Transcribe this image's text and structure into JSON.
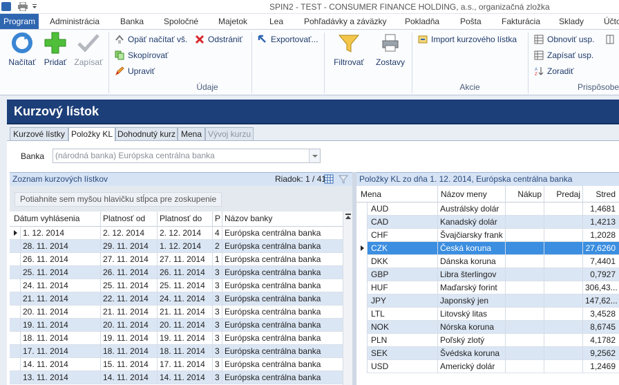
{
  "title_bar": {
    "text": "SPIN2 - TEST - CONSUMER FINANCE HOLDING, a.s., organizačná zložka"
  },
  "menu": {
    "items": [
      {
        "label": "Program",
        "active": true
      },
      {
        "label": "Administrácia"
      },
      {
        "label": "Banka"
      },
      {
        "label": "Spoločné"
      },
      {
        "label": "Majetok"
      },
      {
        "label": "Lea"
      },
      {
        "label": "Pohľadávky a záväzky"
      },
      {
        "label": "Pokladňa"
      },
      {
        "label": "Pošta"
      },
      {
        "label": "Fakturácia"
      },
      {
        "label": "Sklady"
      },
      {
        "label": "Účto"
      }
    ]
  },
  "ribbon": {
    "nacitat": "Načítať",
    "pridat": "Pridať",
    "zapisat": "Zapísať",
    "opat_nacitat": "Opäť načítať vš.",
    "odstranit": "Odstrániť",
    "skopirovat": "Skopírovať",
    "upravit": "Upraviť",
    "exportovat": "Exportovať...",
    "filtrovat": "Filtrovať",
    "zostavy": "Zostavy",
    "import": "Import kurzového lístka",
    "obnovit": "Obnoviť usp.",
    "zapisat_usp": "Zapísať usp.",
    "zoradit": "Zoradiť",
    "group_udaje": "Údaje",
    "group_akcie": "Akcie",
    "group_prisposobit": "Prispôsobe"
  },
  "header": {
    "title": "Kurzový lístok"
  },
  "tabs": [
    {
      "label": "Kurzové lístky"
    },
    {
      "label": "Položky KL",
      "active": true
    },
    {
      "label": "Dohodnutý kurz"
    },
    {
      "label": "Mena"
    },
    {
      "label": "Vývoj kurzu",
      "disabled": true
    }
  ],
  "banka": {
    "label": "Banka",
    "value": "(národná banka) Európska centrálna banka"
  },
  "left_panel": {
    "caption": "Zoznam kurzových lístkov",
    "riadok": "Riadok: 1 / 41",
    "group_prompt": "Potiahnite sem myšou hlavičku stĺpca pre zoskupenie",
    "columns": [
      "Dátum vyhlásenia",
      "Platnosť od",
      "Platnosť do",
      "P",
      "Názov banky"
    ],
    "rows": [
      [
        "1. 12. 2014",
        "2. 12. 2014",
        "2. 12. 2014",
        "4",
        "Európska centrálna banka"
      ],
      [
        "28. 11. 2014",
        "29. 11. 2014",
        "1. 12. 2014",
        "2",
        "Európska centrálna banka"
      ],
      [
        "26. 11. 2014",
        "27. 11. 2014",
        "27. 11. 2014",
        "1",
        "Európska centrálna banka"
      ],
      [
        "25. 11. 2014",
        "26. 11. 2014",
        "26. 11. 2014",
        "3",
        "Európska centrálna banka"
      ],
      [
        "24. 11. 2014",
        "25. 11. 2014",
        "25. 11. 2014",
        "3",
        "Európska centrálna banka"
      ],
      [
        "21. 11. 2014",
        "22. 11. 2014",
        "24. 11. 2014",
        "3",
        "Európska centrálna banka"
      ],
      [
        "20. 11. 2014",
        "21. 11. 2014",
        "21. 11. 2014",
        "3",
        "Európska centrálna banka"
      ],
      [
        "19. 11. 2014",
        "20. 11. 2014",
        "20. 11. 2014",
        "3",
        "Európska centrálna banka"
      ],
      [
        "18. 11. 2014",
        "19. 11. 2014",
        "19. 11. 2014",
        "3",
        "Európska centrálna banka"
      ],
      [
        "17. 11. 2014",
        "18. 11. 2014",
        "18. 11. 2014",
        "3",
        "Európska centrálna banka"
      ],
      [
        "14. 11. 2014",
        "15. 11. 2014",
        "17. 11. 2014",
        "3",
        "Európska centrálna banka"
      ],
      [
        "13. 11. 2014",
        "14. 11. 2014",
        "14. 11. 2014",
        "3",
        "Európska centrálna banka"
      ]
    ],
    "selected_index": 0
  },
  "right_panel": {
    "caption": "Položky KL zo dňa 1. 12. 2014, Európska centrálna banka",
    "columns": [
      "Mena",
      "Názov meny",
      "Nákup",
      "Predaj",
      "Stred"
    ],
    "rows": [
      [
        "AUD",
        "Austrálsky dolár",
        "",
        "",
        "1,4681"
      ],
      [
        "CAD",
        "Kanadský dolár",
        "",
        "",
        "1,4213"
      ],
      [
        "CHF",
        "Švajčiarsky frank",
        "",
        "",
        "1,2028"
      ],
      [
        "CZK",
        "Česká koruna",
        "",
        "",
        "27,6260"
      ],
      [
        "DKK",
        "Dánska koruna",
        "",
        "",
        "7,4401"
      ],
      [
        "GBP",
        "Libra šterlingov",
        "",
        "",
        "0,7927"
      ],
      [
        "HUF",
        "Maďarský forint",
        "",
        "",
        "306,43..."
      ],
      [
        "JPY",
        "Japonský jen",
        "",
        "",
        "147,62..."
      ],
      [
        "LTL",
        "Litovský litas",
        "",
        "",
        "3,4528"
      ],
      [
        "NOK",
        "Nórska koruna",
        "",
        "",
        "8,6745"
      ],
      [
        "PLN",
        "Poľský zlotý",
        "",
        "",
        "4,1782"
      ],
      [
        "SEK",
        "Švédska koruna",
        "",
        "",
        "9,2562"
      ],
      [
        "USD",
        "Americký dolár",
        "",
        "",
        "1,2469"
      ]
    ],
    "selected_index": 3
  },
  "colors": {
    "accent": "#2f66b0",
    "header_bg": "#1d3f79",
    "row_alt": "#dbe6f4",
    "row_selected": "#3b8ee0"
  }
}
